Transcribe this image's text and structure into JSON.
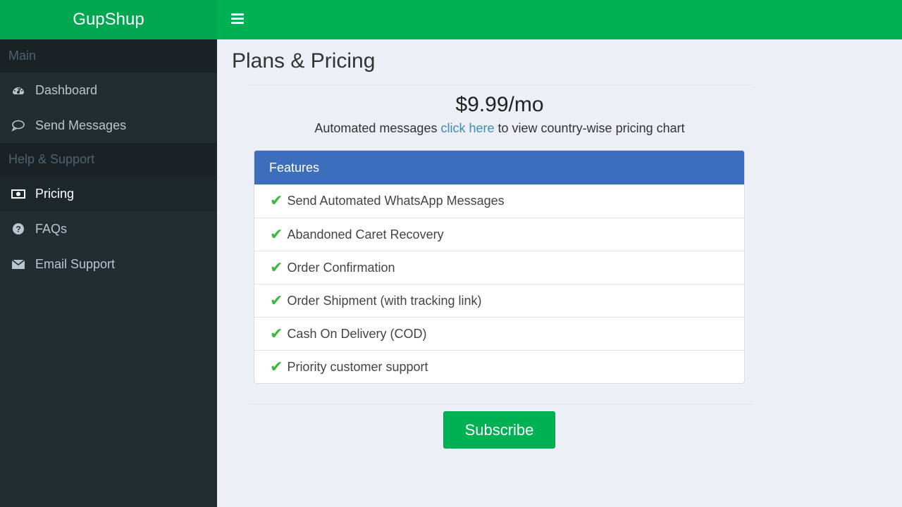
{
  "brand": {
    "name": "GupShup"
  },
  "sidebar": {
    "sections": [
      {
        "header": "Main",
        "items": [
          {
            "label": "Dashboard",
            "icon": "dashboard-icon"
          },
          {
            "label": "Send Messages",
            "icon": "chat-bubble-icon"
          }
        ]
      },
      {
        "header": "Help & Support",
        "items": [
          {
            "label": "Pricing",
            "icon": "money-icon",
            "active": true
          },
          {
            "label": "FAQs",
            "icon": "question-circle-icon"
          },
          {
            "label": "Email Support",
            "icon": "envelope-icon"
          }
        ]
      }
    ]
  },
  "topbar": {
    "menu_icon": "hamburger-icon"
  },
  "main": {
    "title": "Plans & Pricing",
    "price": "$9.99/mo",
    "subtitle_prefix": "Automated messages",
    "subtitle_link": "click here",
    "subtitle_suffix": "to view country-wise pricing chart",
    "features_header": "Features",
    "features": [
      "Send Automated WhatsApp Messages",
      "Abandoned Caret Recovery",
      "Order Confirmation",
      "Order Shipment (with tracking link)",
      "Cash On Delivery (COD)",
      "Priority customer support"
    ],
    "check_glyph": "✔",
    "subscribe_label": "Subscribe"
  },
  "colors": {
    "brand_green": "#00a650",
    "topbar_green": "#00b154",
    "sidebar_bg": "#222d32",
    "panel_header": "#3d6ebb",
    "link": "#3c8dbc",
    "check": "#3cb83c"
  }
}
